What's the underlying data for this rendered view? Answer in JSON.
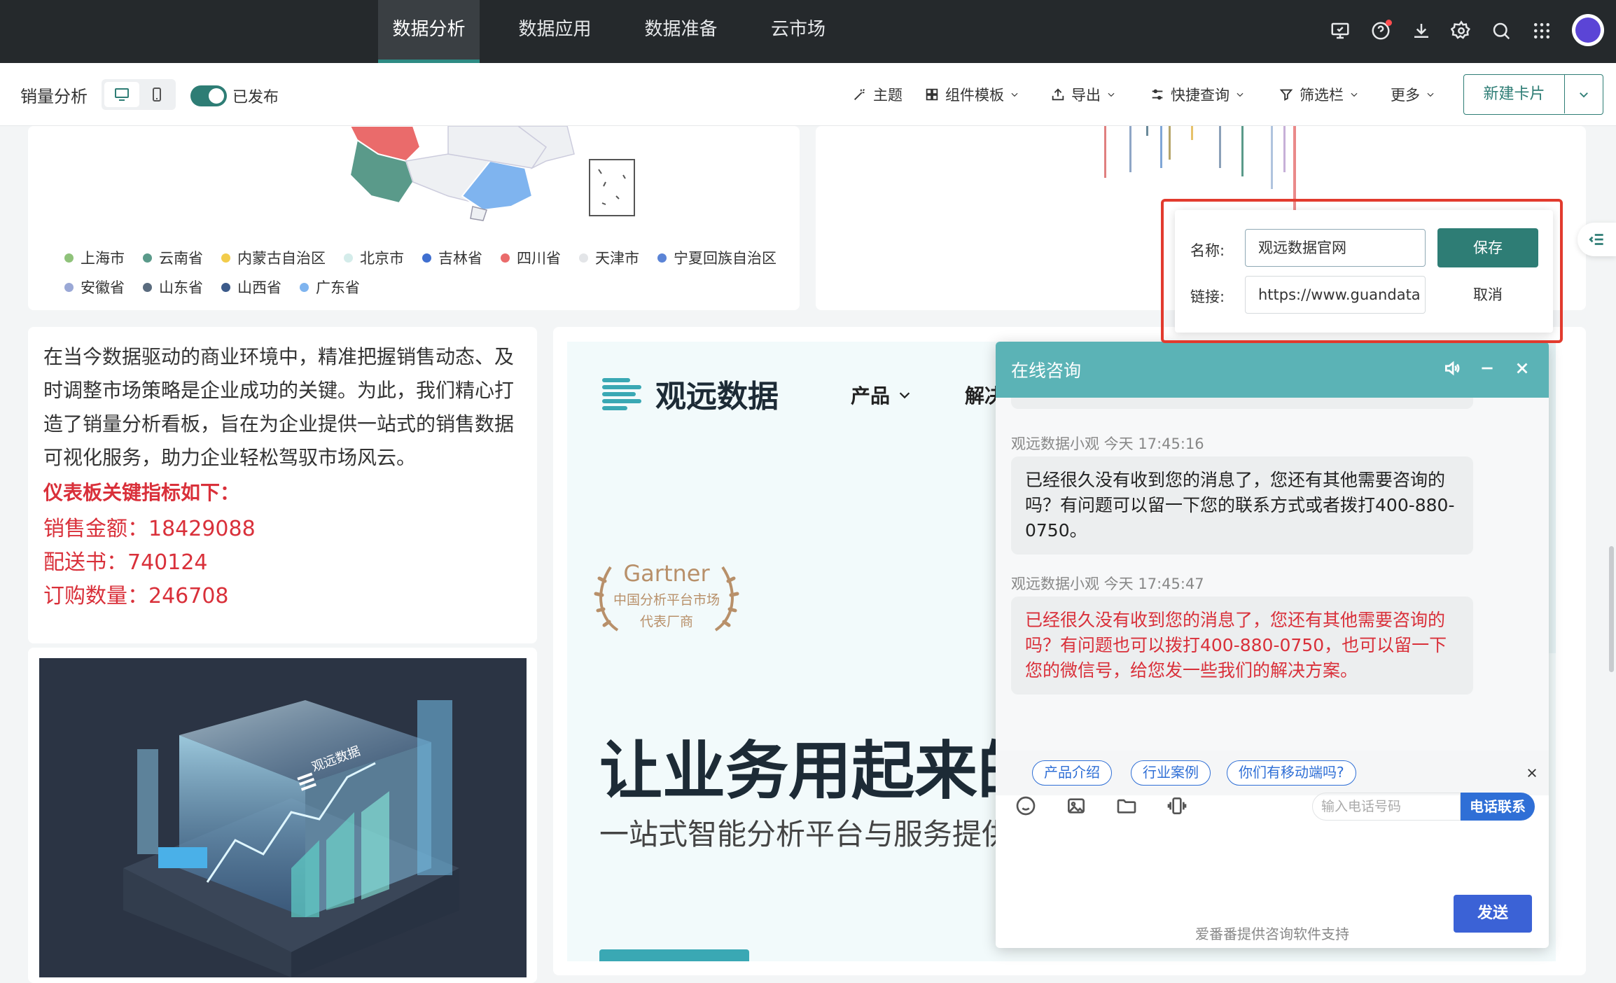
{
  "nav": {
    "tabs": [
      "数据分析",
      "数据应用",
      "数据准备",
      "云市场"
    ]
  },
  "icons": [
    "monitor-icon",
    "help-icon",
    "download-icon",
    "gear-icon",
    "search-icon",
    "apps-grid-icon"
  ],
  "toolbar": {
    "page_title": "销量分析",
    "publish_label": "已发布",
    "theme": "主题",
    "component_template": "组件模板",
    "export": "导出",
    "quick_query": "快捷查询",
    "filter_bar": "筛选栏",
    "more": "更多",
    "new_card": "新建卡片"
  },
  "legend": {
    "row1": [
      {
        "name": "上海市",
        "color": "#8fc27a"
      },
      {
        "name": "云南省",
        "color": "#5a9a8a"
      },
      {
        "name": "内蒙古自治区",
        "color": "#f2cc4b"
      },
      {
        "name": "北京市",
        "color": "#d4ecea"
      },
      {
        "name": "吉林省",
        "color": "#3f6fd0"
      },
      {
        "name": "四川省",
        "color": "#ea6b6b"
      },
      {
        "name": "天津市",
        "color": "#e3e5e8"
      },
      {
        "name": "宁夏回族自治区",
        "color": "#5b84d6"
      }
    ],
    "row2": [
      {
        "name": "安徽省",
        "color": "#9aa8d6"
      },
      {
        "name": "山东省",
        "color": "#5a6b7e"
      },
      {
        "name": "山西省",
        "color": "#3b5a8a"
      },
      {
        "name": "广东省",
        "color": "#7fb4ef"
      }
    ]
  },
  "text_card": {
    "intro": "在当今数据驱动的商业环境中，精准把握销售动态、及时调整市场策略是企业成功的关键。为此，我们精心打造了销量分析看板，旨在为企业提供一站式的销售数据可视化服务，助力企业轻松驾驭市场风云。",
    "kpi_heading": "仪表板关键指标如下：",
    "kpi1": "销售金额：18429088",
    "kpi2": "配送书：740124",
    "kpi3": "订购数量：246708"
  },
  "image_card": {
    "logo_text": "观远数据"
  },
  "link_popup": {
    "name_label": "名称:",
    "name_value": "观远数据官网",
    "link_label": "链接:",
    "link_value": "https://www.guandata",
    "save": "保存",
    "cancel": "取消"
  },
  "website": {
    "brand": "观远数据",
    "nav_product": "产品",
    "nav_solution": "解决",
    "gartner_title": "Gartner",
    "gartner_line1": "中国分析平台市场",
    "gartner_line2": "代表厂商",
    "hero": "让业务用起来的",
    "hero_sub": "一站式智能分析平台与服务提供"
  },
  "chat": {
    "title": "在线咨询",
    "msg1_meta": "观远数据小观 今天 17:45:16",
    "msg1_text": "已经很久没有收到您的消息了，您还有其他需要咨询的吗？有问题可以留一下您的联系方式或者拨打400-880-0750。",
    "msg2_meta": "观远数据小观 今天 17:45:47",
    "msg2_text": "已经很久没有收到您的消息了，您还有其他需要咨询的吗？有问题也可以拨打400-880-0750，也可以留一下您的微信号，给您发一些我们的解决方案。",
    "chips": [
      "产品介绍",
      "行业案例",
      "你们有移动端吗?"
    ],
    "phone_placeholder": "输入电话号码",
    "phone_button": "电话联系",
    "send": "发送",
    "powered_by": "爱番番提供咨询软件支持"
  }
}
